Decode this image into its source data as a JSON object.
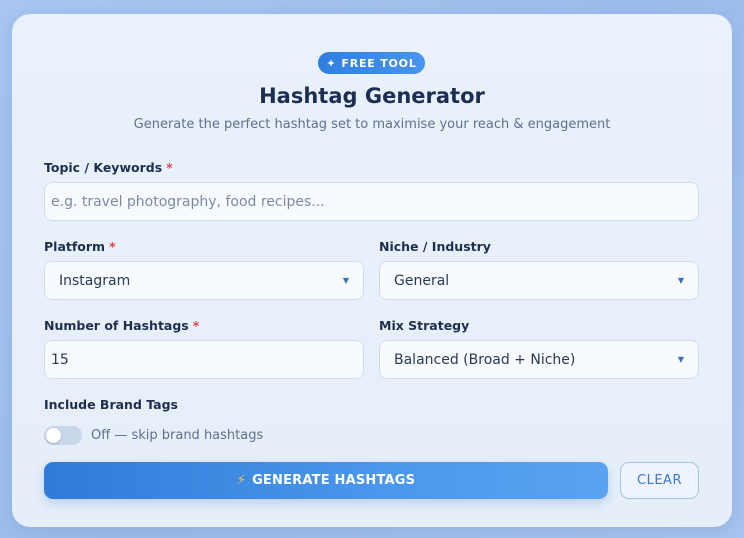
{
  "header": {
    "badge_icon": "✦",
    "badge_label": "FREE TOOL",
    "title": "Hashtag Generator",
    "subtitle": "Generate the perfect hashtag set to maximise your reach & engagement"
  },
  "form": {
    "required_mark": "*",
    "topic": {
      "label": "Topic / Keywords",
      "placeholder": "e.g. travel photography, food recipes...",
      "value": ""
    },
    "platform": {
      "label": "Platform",
      "selected": "Instagram"
    },
    "niche": {
      "label": "Niche / Industry",
      "selected": "General"
    },
    "count": {
      "label": "Number of Hashtags",
      "value": "15"
    },
    "mix": {
      "label": "Mix Strategy",
      "selected": "Balanced (Broad + Niche)"
    },
    "brand_tags": {
      "label": "Include Brand Tags",
      "state_text": "Off — skip brand hashtags",
      "enabled": false
    }
  },
  "actions": {
    "generate_icon": "⚡",
    "generate_label": "GENERATE HASHTAGS",
    "clear_label": "CLEAR"
  },
  "colors": {
    "accent": "#3a86e4",
    "required": "#e0474c",
    "title": "#1c2f52"
  }
}
